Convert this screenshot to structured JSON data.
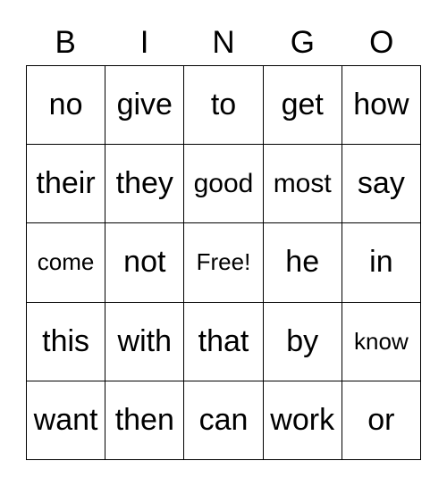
{
  "header": [
    "B",
    "I",
    "N",
    "G",
    "O"
  ],
  "cells": [
    [
      "no",
      "give",
      "to",
      "get",
      "how"
    ],
    [
      "their",
      "they",
      "good",
      "most",
      "say"
    ],
    [
      "come",
      "not",
      "Free!",
      "he",
      "in"
    ],
    [
      "this",
      "with",
      "that",
      "by",
      "know"
    ],
    [
      "want",
      "then",
      "can",
      "work",
      "or"
    ]
  ]
}
